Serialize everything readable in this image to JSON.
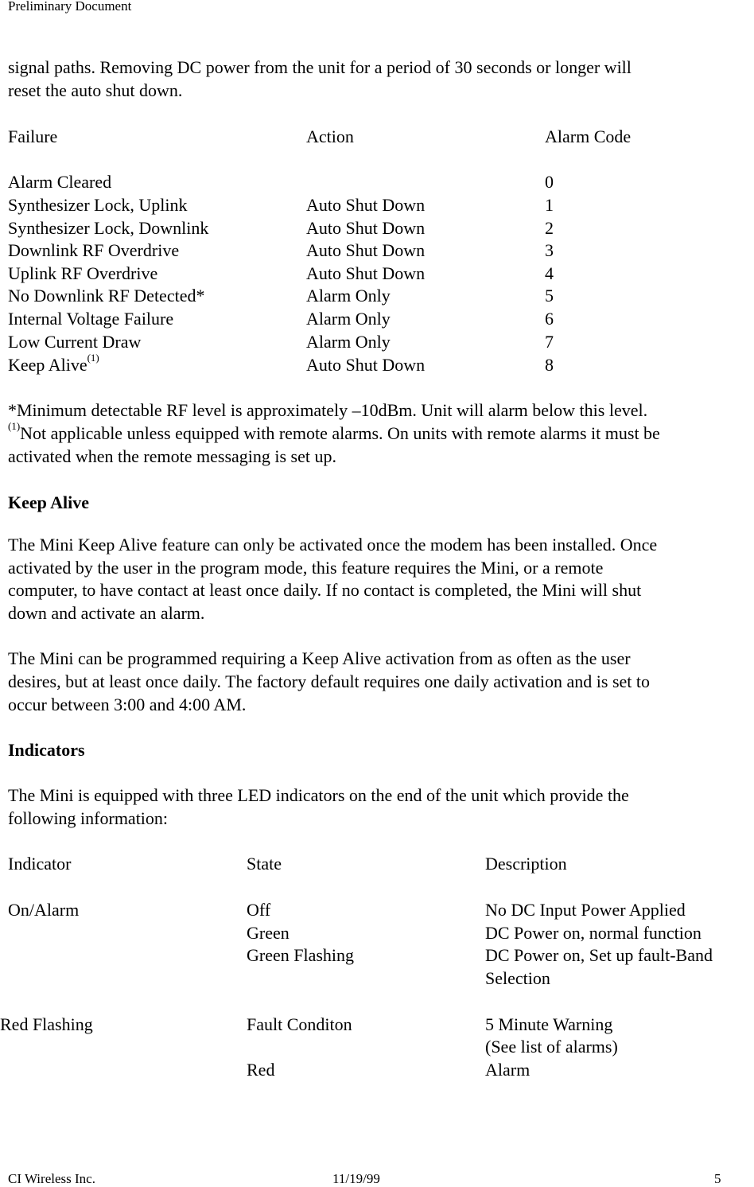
{
  "header": {
    "title": "Preliminary Document"
  },
  "intro": {
    "line1": "signal paths.  Removing DC power from the unit for a period of 30 seconds or longer will",
    "line2": "reset the auto shut down."
  },
  "alarm_table": {
    "headers": {
      "failure": "Failure",
      "action": "Action",
      "code": "Alarm Code"
    },
    "rows": [
      {
        "failure": "Alarm Cleared",
        "action": "",
        "code": "0"
      },
      {
        "failure": "Synthesizer Lock, Uplink",
        "action": "Auto Shut Down",
        "code": "1"
      },
      {
        "failure": "Synthesizer Lock, Downlink",
        "action": "Auto Shut Down",
        "code": "2"
      },
      {
        "failure": "Downlink RF Overdrive",
        "action": "Auto Shut Down",
        "code": "3"
      },
      {
        "failure": "Uplink RF Overdrive",
        "action": "Auto Shut Down",
        "code": "4"
      },
      {
        "failure": "No Downlink RF Detected*",
        "action": "Alarm Only",
        "code": "5"
      },
      {
        "failure": "Internal Voltage Failure",
        "action": "Alarm Only",
        "code": "6"
      },
      {
        "failure": "Low Current Draw",
        "action": "Alarm Only",
        "code": "7"
      },
      {
        "failure": "Keep Alive",
        "failure_sup": "(1)",
        "action": "Auto Shut Down",
        "code": "8"
      }
    ]
  },
  "notes": {
    "note1": "*Minimum detectable RF level is approximately –10dBm.  Unit will alarm below this level.",
    "note2_sup": "(1)",
    "note2_line1": "Not applicable unless equipped with remote alarms.  On units with remote alarms it must be",
    "note2_line2": "activated when the remote messaging is set up."
  },
  "keep_alive": {
    "heading": "Keep Alive",
    "para1": [
      "The Mini Keep Alive feature can only be activated once the modem has been installed.  Once",
      "activated by the user in the program mode, this feature requires the Mini, or a remote",
      "computer, to have contact at least once daily.  If no contact is completed, the Mini will shut",
      "down and activate an alarm."
    ],
    "para2": [
      "The Mini can be programmed requiring a Keep Alive activation from as often as the user",
      "desires, but at least once daily.  The factory default requires one daily activation and is set to",
      "occur between 3:00 and 4:00 AM."
    ]
  },
  "indicators": {
    "heading": "Indicators",
    "intro": [
      "The Mini is equipped with three LED indicators on the end of the unit which provide the",
      "following information:"
    ],
    "headers": {
      "indicator": "Indicator",
      "state": "State",
      "description": "Description"
    },
    "rows": [
      {
        "indicator": "On/Alarm",
        "state": "Off",
        "description": "No DC Input Power Applied"
      },
      {
        "indicator": "",
        "state": "Green",
        "description": "DC Power on, normal function"
      },
      {
        "indicator": "",
        "state": "Green Flashing",
        "description": "DC Power on, Set up fault-Band"
      },
      {
        "indicator": "",
        "state": "",
        "description": "Selection"
      },
      {
        "indicator": "Red Flashing",
        "state": "Fault Conditon",
        "description": "5 Minute Warning"
      },
      {
        "indicator": "",
        "state": "",
        "description": "(See list of alarms)"
      },
      {
        "indicator": "",
        "state": "Red",
        "description": "Alarm"
      }
    ]
  },
  "footer": {
    "company": "CI Wireless Inc.",
    "date": "11/19/99",
    "page": "5"
  }
}
